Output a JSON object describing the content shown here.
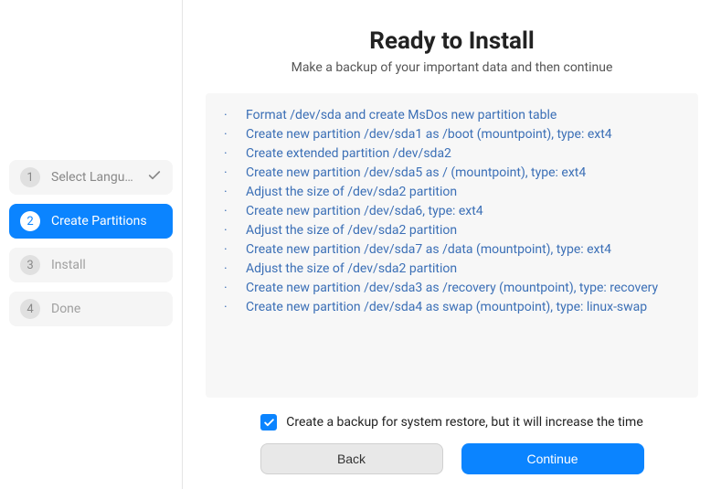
{
  "sidebar": {
    "steps": [
      {
        "number": "1",
        "label": "Select Langu…",
        "state": "completed"
      },
      {
        "number": "2",
        "label": "Create Partitions",
        "state": "active"
      },
      {
        "number": "3",
        "label": "Install",
        "state": "pending"
      },
      {
        "number": "4",
        "label": "Done",
        "state": "pending"
      }
    ]
  },
  "main": {
    "title": "Ready to Install",
    "subtitle": "Make a backup of your important data and then continue",
    "operations": [
      "Format /dev/sda and create MsDos new partition table",
      "Create new partition /dev/sda1 as /boot (mountpoint), type: ext4",
      "Create extended partition /dev/sda2",
      "Create new partition /dev/sda5 as / (mountpoint), type: ext4",
      "Adjust the size of /dev/sda2 partition",
      "Create new partition /dev/sda6, type: ext4",
      "Adjust the size of /dev/sda2 partition",
      "Create new partition /dev/sda7 as /data (mountpoint), type: ext4",
      "Adjust the size of /dev/sda2 partition",
      "Create new partition /dev/sda3 as /recovery (mountpoint), type: recovery",
      "Create new partition /dev/sda4 as swap (mountpoint), type: linux-swap"
    ],
    "backup_checkbox": {
      "checked": true,
      "label": "Create a backup for system restore, but it will increase the time"
    },
    "buttons": {
      "back": "Back",
      "continue": "Continue"
    }
  }
}
